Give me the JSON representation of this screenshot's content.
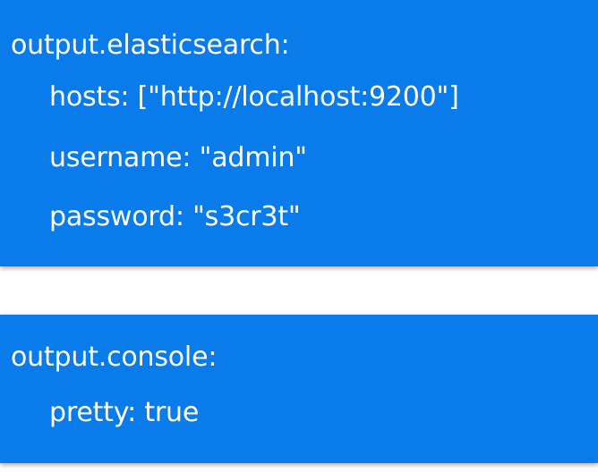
{
  "colors": {
    "panel_background": "#0a7bea",
    "text": "#ffffff",
    "page_background": "#ffffff"
  },
  "panels": [
    {
      "lines": [
        "output.elasticsearch:",
        "hosts: [\"http://localhost:9200\"]",
        "username: \"admin\"",
        "password: \"s3cr3t\""
      ]
    },
    {
      "lines": [
        "output.console:",
        "pretty: true"
      ]
    }
  ]
}
